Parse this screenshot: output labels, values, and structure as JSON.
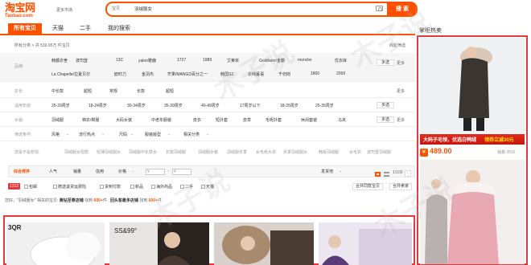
{
  "header": {
    "logo_cn": "淘宝网",
    "logo_en": "Taobao.com",
    "more_market": "更多市场",
    "search_scope": "宝贝",
    "search_query": "羽绒服女",
    "search_button": "搜 索"
  },
  "tabs": [
    "所有宝贝",
    "天猫",
    "二手",
    "我的搜索"
  ],
  "sidebar_title": "掌柜热卖",
  "filter": {
    "all_prefix": "所有分类 > 共 539.95万 件宝贝",
    "collapse": "收起筛选",
    "rows": [
      {
        "label": "品牌:",
        "items": [
          "韩都衣舍",
          "波司登",
          "13C",
          "yaloo雅鹿",
          "1727",
          "1989",
          "艾莱依",
          "Goldfarm/金霸",
          "moncler",
          "优衣库",
          "La Chapelle/拉夏贝尔",
          "欧时力",
          "金羽杰",
          "芒果/MANGO",
          "百分之一",
          "韩国SZ",
          "衣纯蔓语",
          "千仞岗",
          "1800",
          "2099"
        ],
        "aside": "多选",
        "more": "更多"
      },
      {
        "label": "衣长:",
        "items": [
          "中长款",
          "超短",
          "常规",
          "长款",
          "超短"
        ],
        "aside": "",
        "more": "更多"
      },
      {
        "label": "适用年龄:",
        "items": [
          "25-29周岁",
          "18-24周岁",
          "30-34周岁",
          "35-39周岁",
          "40-49周岁",
          "17周岁以下",
          "18-25周岁",
          "25-35周岁"
        ],
        "aside": "多选",
        "more": ""
      },
      {
        "label": "女装:",
        "items": [
          "羽绒服",
          "棉衣/棉服",
          "大码女装",
          "中老年服装",
          "皮衣",
          "短外套",
          "皮草",
          "毛呢外套",
          "休闲套装",
          "马夹"
        ],
        "aside": "多选",
        "more": "更多"
      },
      {
        "label": "筛选条件:",
        "items": [
          "风格",
          "流行热点",
          "尺码",
          "服装版型",
          "相关分类"
        ],
        "aside": "",
        "more": ""
      }
    ]
  },
  "related": {
    "label": "您是不是想找:",
    "items": [
      "羽绒服女短款",
      "轻薄羽绒服女",
      "羽绒服中长款女",
      "长款羽绒服",
      "羽绒服女装",
      "羽绒服冬季",
      "女毛呢大衣",
      "反季羽绒服女",
      "韩版羽绒服",
      "女毛衣",
      "波司登羽绒服"
    ]
  },
  "sortbar": {
    "items": [
      "综合排序",
      "人气",
      "销量",
      "信用",
      "价格"
    ],
    "price_from": "¥",
    "price_to": "¥",
    "ship": "发货地",
    "page": "1/100"
  },
  "services": {
    "badge": "1212",
    "items": [
      "包邮",
      "赠送退货运费险",
      "货到付款",
      "新品",
      "海外商品",
      "二手",
      "天猫"
    ],
    "ship_select": "合并同款宝贝",
    "btn": "合并卖家"
  },
  "recommend": {
    "prefix": "您好，\"羽绒服女\" 相关的宝贝:",
    "shop1": "黄钻至尊店铺",
    "mid1": "找到",
    "num1": "600+",
    "suffix1": "件",
    "shop2": "回头客最多店铺",
    "mid2": "找到",
    "num2": "600+",
    "suffix2": "件"
  },
  "products": [
    {
      "label": "3QR",
      "color": "#f1f1f1"
    },
    {
      "label": "SS&99°",
      "color": "#1a1a1a"
    },
    {
      "label": "",
      "color": "#3a2c28"
    },
    {
      "label": "",
      "color": "#8a6a5a"
    },
    {
      "label": "",
      "color": "#5a3a78"
    }
  ],
  "sidebar_ad": {
    "banner_left": "大码子毛领，优选白鸭绒",
    "banner_right": "领券立减30元",
    "price": "489.00",
    "sales_label": "销量:",
    "sales": "3502",
    "tag": "¥"
  },
  "watermark": "木子说"
}
